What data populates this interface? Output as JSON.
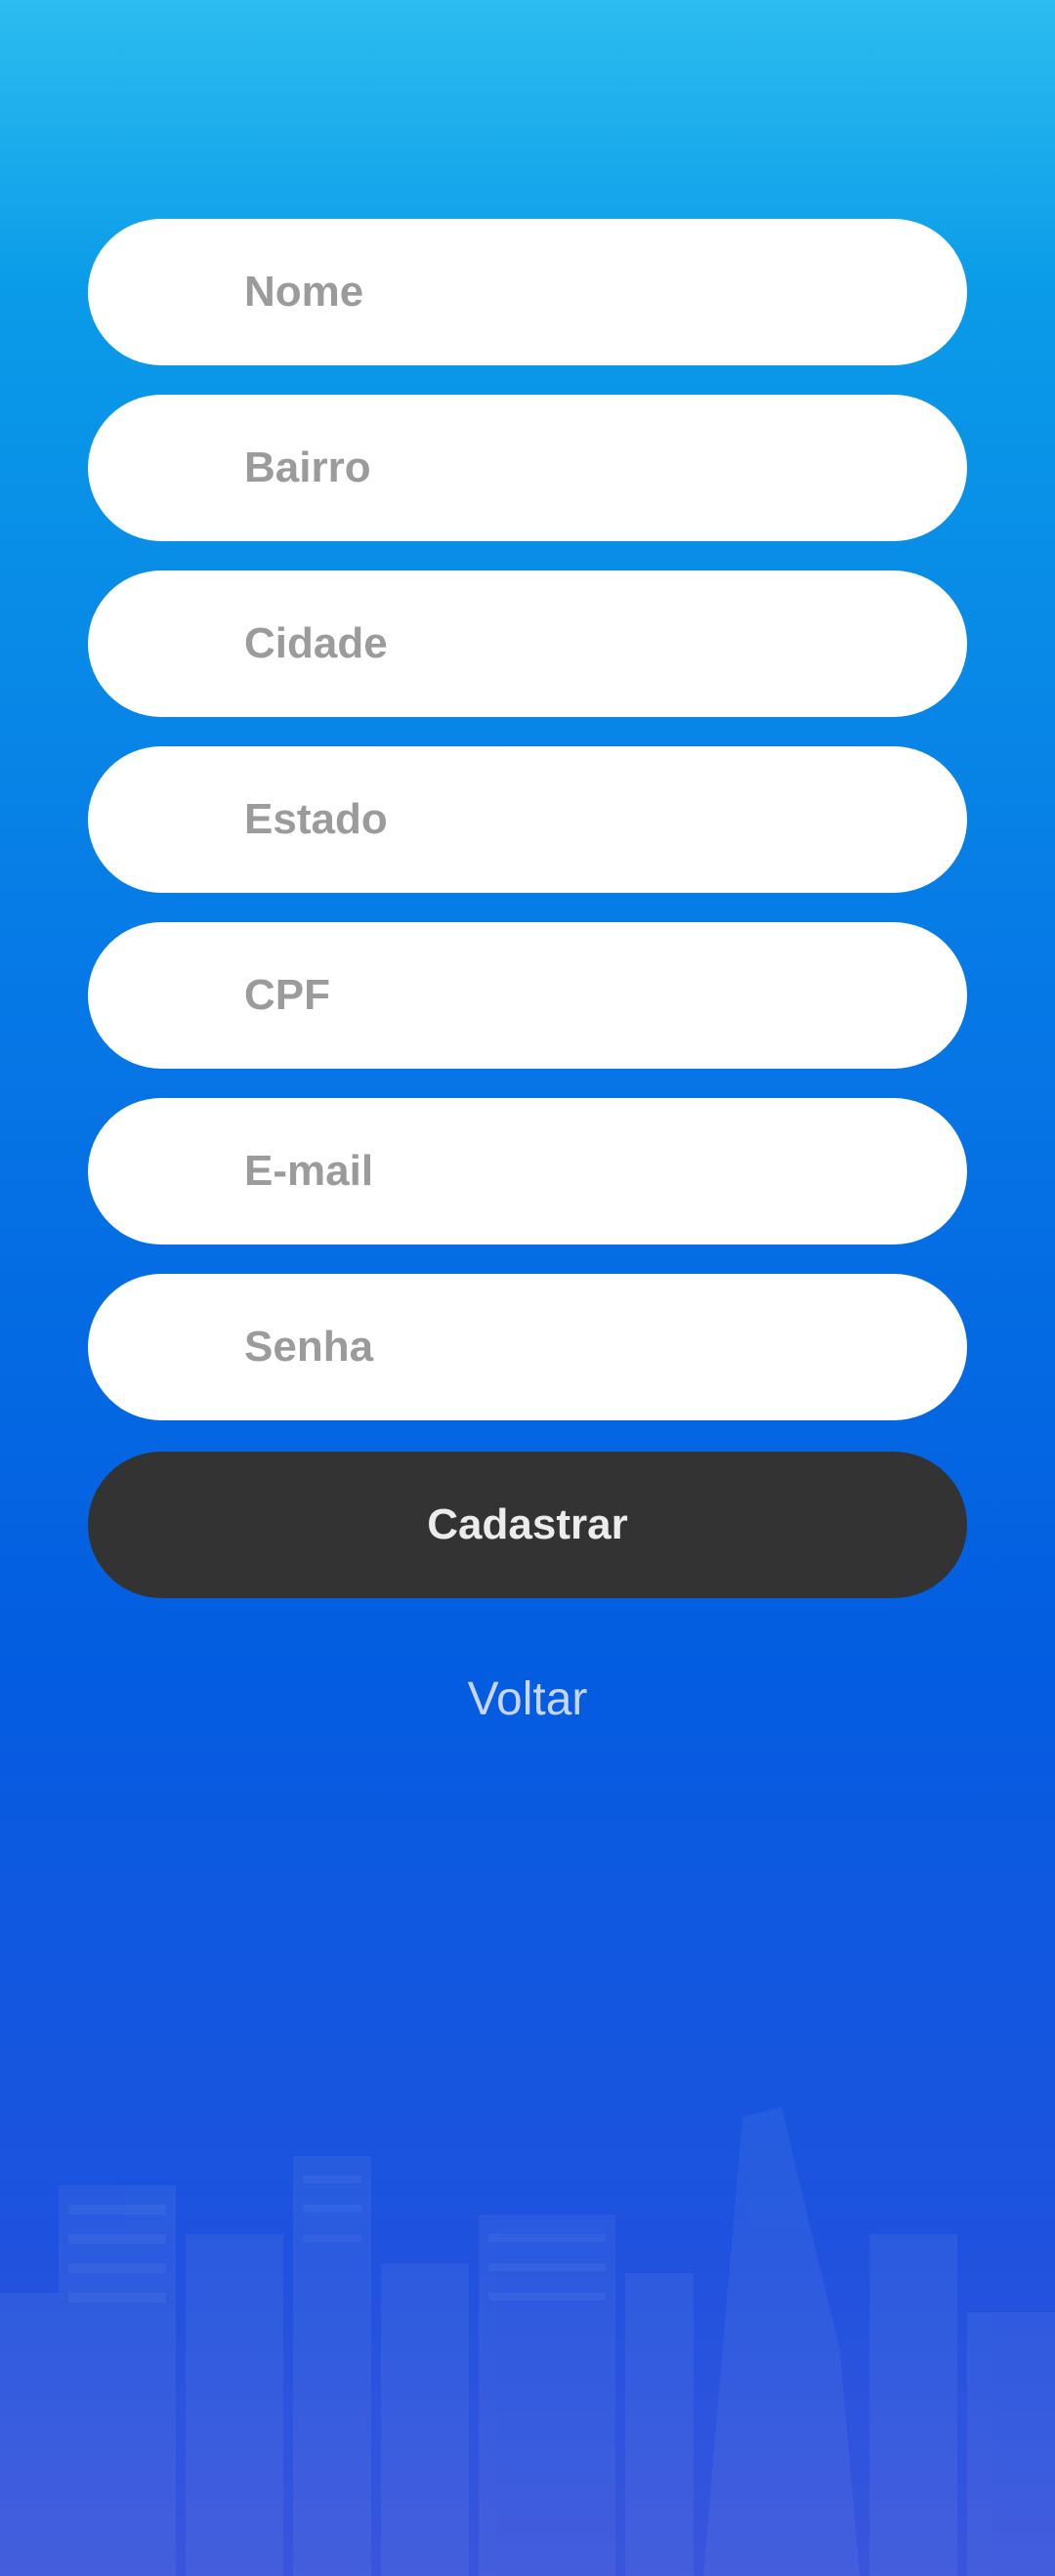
{
  "form": {
    "fields": [
      {
        "placeholder": "Nome",
        "type": "text"
      },
      {
        "placeholder": "Bairro",
        "type": "text"
      },
      {
        "placeholder": "Cidade",
        "type": "text"
      },
      {
        "placeholder": "Estado",
        "type": "text"
      },
      {
        "placeholder": "CPF",
        "type": "text"
      },
      {
        "placeholder": "E-mail",
        "type": "email"
      },
      {
        "placeholder": "Senha",
        "type": "password"
      }
    ],
    "submit_label": "Cadastrar",
    "back_label": "Voltar"
  },
  "colors": {
    "background_top": "#2cbcf0",
    "background_bottom": "#1f52de",
    "field_background": "#ffffff",
    "placeholder_text": "#9b9b9b",
    "button_background": "#333333",
    "button_text": "#ececec",
    "link_text": "#c8d6ff"
  }
}
